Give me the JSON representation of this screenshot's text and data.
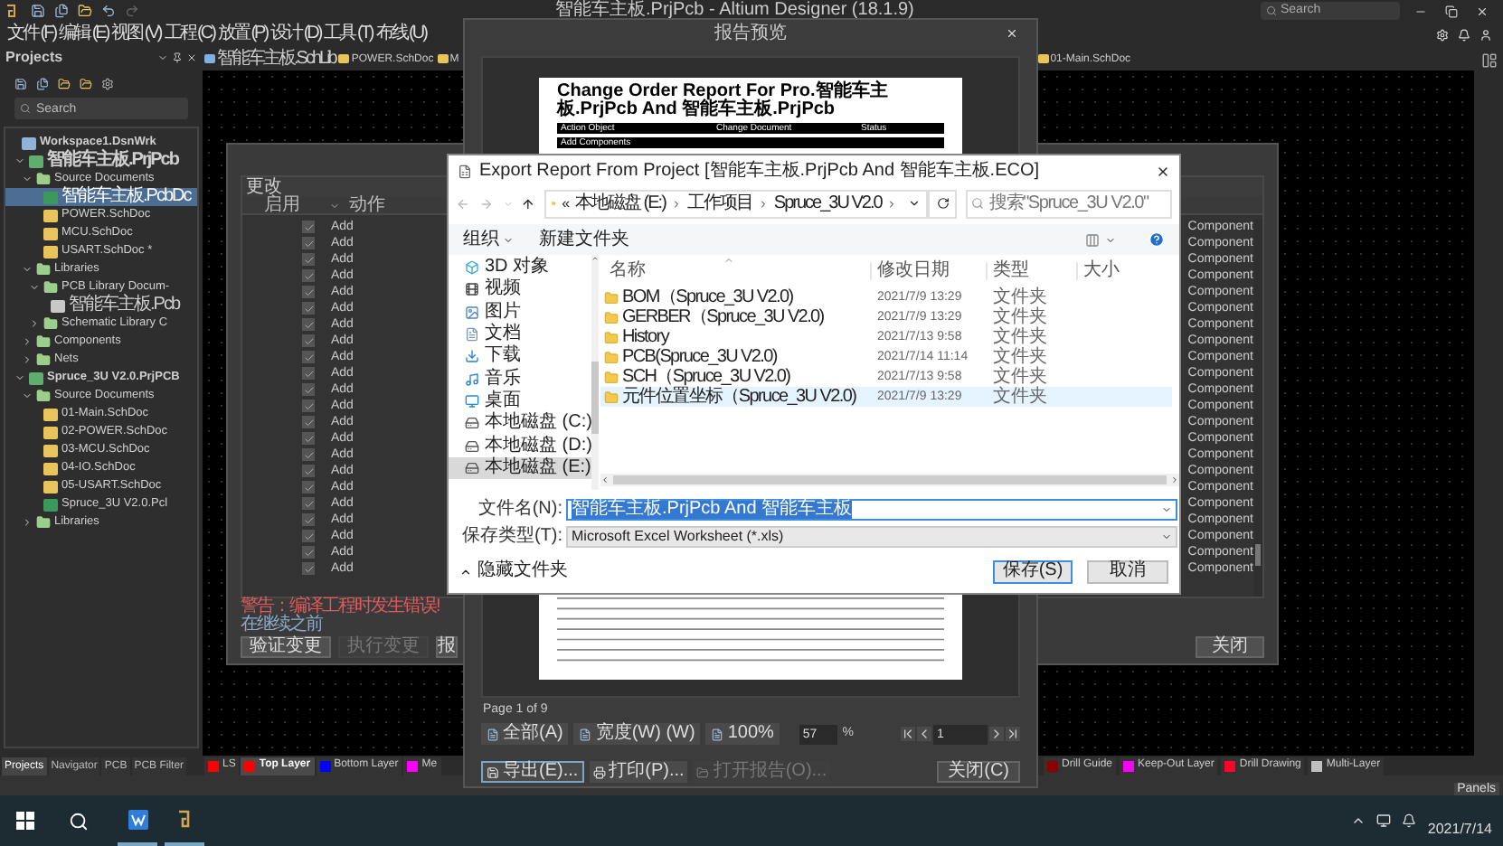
{
  "app": {
    "title": "智能车主板.PrjPcb - Altium Designer (18.1.9)",
    "search_placeholder": "Search"
  },
  "menu": [
    "文件 (F)",
    "编辑 (E)",
    "视图 (V)",
    "工程 (C)",
    "放置 (P)",
    "设计 (D)",
    "工具 (T)",
    "布线 (U)"
  ],
  "projects_panel": {
    "title": "Projects",
    "search_placeholder": "Search",
    "tree": [
      {
        "label": "Workspace1.DsnWrk",
        "kind": "workspace",
        "selected": false,
        "children": [
          {
            "label": "智能车主板.PrjPcb",
            "kind": "project",
            "selected": false,
            "expanded": true,
            "children": [
              {
                "label": "Source Documents",
                "kind": "folder",
                "selected": false,
                "expanded": true,
                "children": [
                  {
                    "label": "智能车主板.PcbDc",
                    "kind": "pcbdoc",
                    "selected": true
                  },
                  {
                    "label": "POWER.SchDoc",
                    "kind": "schdoc",
                    "selected": false
                  },
                  {
                    "label": "MCU.SchDoc",
                    "kind": "schdoc",
                    "selected": false
                  },
                  {
                    "label": "USART.SchDoc *",
                    "kind": "schdoc",
                    "selected": false
                  }
                ]
              },
              {
                "label": "Libraries",
                "kind": "folder",
                "selected": false,
                "expanded": true,
                "children": [
                  {
                    "label": "PCB Library Docum-",
                    "kind": "folder",
                    "selected": false,
                    "expanded": true,
                    "children": [
                      {
                        "label": "智能车主板.Pcb",
                        "kind": "pcblib",
                        "selected": false
                      }
                    ]
                  },
                  {
                    "label": "Schematic Library C",
                    "kind": "folder",
                    "selected": false,
                    "expanded": false
                  }
                ]
              },
              {
                "label": "Components",
                "kind": "folder",
                "selected": false,
                "expanded": false
              },
              {
                "label": "Nets",
                "kind": "folder",
                "selected": false,
                "expanded": false
              }
            ]
          },
          {
            "label": "Spruce_3U V2.0.PrjPCB",
            "kind": "project",
            "selected": false,
            "expanded": true,
            "children": [
              {
                "label": "Source Documents",
                "kind": "folder",
                "selected": false,
                "expanded": true,
                "children": [
                  {
                    "label": "01-Main.SchDoc",
                    "kind": "schdoc",
                    "selected": false
                  },
                  {
                    "label": "02-POWER.SchDoc",
                    "kind": "schdoc",
                    "selected": false
                  },
                  {
                    "label": "03-MCU.SchDoc",
                    "kind": "schdoc",
                    "selected": false
                  },
                  {
                    "label": "04-IO.SchDoc",
                    "kind": "schdoc",
                    "selected": false
                  },
                  {
                    "label": "05-USART.SchDoc",
                    "kind": "schdoc",
                    "selected": false
                  },
                  {
                    "label": "Spruce_3U V2.0.Pcl",
                    "kind": "pcbdoc",
                    "selected": false
                  }
                ]
              },
              {
                "label": "Libraries",
                "kind": "folder",
                "selected": false,
                "expanded": false
              }
            ]
          }
        ]
      }
    ]
  },
  "doc_tabs": [
    {
      "label": "智能车主板.SchLib",
      "kind": "schlib"
    },
    {
      "label": "POWER.SchDoc",
      "kind": "schdoc"
    },
    {
      "label": "M",
      "kind": "schdoc"
    },
    {
      "label": "01-Main.SchDoc",
      "kind": "schdoc"
    }
  ],
  "eco": {
    "section": "更改",
    "columns": [
      "启用",
      "动作"
    ],
    "rows": [
      {
        "enabled": true,
        "action": "Add",
        "type": "Component"
      },
      {
        "enabled": true,
        "action": "Add",
        "type": "Component"
      },
      {
        "enabled": true,
        "action": "Add",
        "type": "Component"
      },
      {
        "enabled": true,
        "action": "Add",
        "type": "Component"
      },
      {
        "enabled": true,
        "action": "Add",
        "type": "Component"
      },
      {
        "enabled": true,
        "action": "Add",
        "type": "Component"
      },
      {
        "enabled": true,
        "action": "Add",
        "type": "Component"
      },
      {
        "enabled": true,
        "action": "Add",
        "type": "Component"
      },
      {
        "enabled": true,
        "action": "Add",
        "type": "Component"
      },
      {
        "enabled": true,
        "action": "Add",
        "type": "Component"
      },
      {
        "enabled": true,
        "action": "Add",
        "type": "Component"
      },
      {
        "enabled": true,
        "action": "Add",
        "type": "Component"
      },
      {
        "enabled": true,
        "action": "Add",
        "type": "Component"
      },
      {
        "enabled": true,
        "action": "Add",
        "type": "Component"
      },
      {
        "enabled": true,
        "action": "Add",
        "type": "Component"
      },
      {
        "enabled": true,
        "action": "Add",
        "type": "Component"
      },
      {
        "enabled": true,
        "action": "Add",
        "type": "Component"
      },
      {
        "enabled": true,
        "action": "Add",
        "type": "Component"
      },
      {
        "enabled": true,
        "action": "Add",
        "type": "Component"
      },
      {
        "enabled": true,
        "action": "Add",
        "type": "Component"
      },
      {
        "enabled": true,
        "action": "Add",
        "type": "Component"
      },
      {
        "enabled": true,
        "action": "Add",
        "type": "Component"
      }
    ],
    "warning": "警告：编译工程时发生错误!",
    "warning_hint": "在继续之前",
    "buttons": [
      {
        "label": "验证变更",
        "disabled": false
      },
      {
        "label": "执行变更",
        "disabled": true
      },
      {
        "label": "报",
        "disabled": false
      }
    ],
    "close": "关闭"
  },
  "report": {
    "title": "报告预览",
    "page": {
      "heading": "Change Order Report For Pro.智能车主板.PrjPcb And 智能车主板.PrjPcb",
      "columns": [
        "Action Object",
        "Change Document",
        "Status"
      ],
      "section": "Add Components"
    },
    "page_indicator": "Page 1 of 9",
    "view_buttons": [
      "全部(A)",
      "宽度(W) (W)",
      "100%"
    ],
    "zoom": "57",
    "zoom_unit": "%",
    "page_number": "1",
    "actions": [
      {
        "label": "导出(E)...",
        "disabled": false
      },
      {
        "label": "打印(P)...",
        "disabled": false
      },
      {
        "label": "打开报告(O)...",
        "disabled": true
      }
    ],
    "close": "关闭(C)"
  },
  "export": {
    "title": "Export Report From Project [智能车主板.PrjPcb And 智能车主板.ECO]",
    "path_prefix": "«",
    "path": [
      "本地磁盘 (E:)",
      "工作项目",
      "Spruce_3U V2.0"
    ],
    "search_placeholder": "搜索\"Spruce_3U V2.0\"",
    "organize": "组织",
    "new_folder": "新建文件夹",
    "nav": [
      {
        "label": "3D 对象",
        "kind": "objects",
        "selected": false
      },
      {
        "label": "视频",
        "kind": "video",
        "selected": false
      },
      {
        "label": "图片",
        "kind": "pictures",
        "selected": false
      },
      {
        "label": "文档",
        "kind": "documents",
        "selected": false
      },
      {
        "label": "下载",
        "kind": "downloads",
        "selected": false
      },
      {
        "label": "音乐",
        "kind": "music",
        "selected": false
      },
      {
        "label": "桌面",
        "kind": "desktop",
        "selected": false
      },
      {
        "label": "本地磁盘 (C:)",
        "kind": "drive",
        "selected": false
      },
      {
        "label": "本地磁盘 (D:)",
        "kind": "drive",
        "selected": false
      },
      {
        "label": "本地磁盘 (E:)",
        "kind": "drive",
        "selected": true
      }
    ],
    "columns": [
      "名称",
      "修改日期",
      "类型",
      "大小"
    ],
    "files": [
      {
        "name": "BOM（Spruce_3U V2.0)",
        "date": "2021/7/9 13:29",
        "type": "文件夹",
        "selected": false
      },
      {
        "name": "GERBER（Spruce_3U V2.0)",
        "date": "2021/7/9 13:29",
        "type": "文件夹",
        "selected": false
      },
      {
        "name": "History",
        "date": "2021/7/13 9:58",
        "type": "文件夹",
        "selected": false
      },
      {
        "name": "PCB(Spruce_3U V2.0)",
        "date": "2021/7/14 11:14",
        "type": "文件夹",
        "selected": false
      },
      {
        "name": "SCH（Spruce_3U V2.0)",
        "date": "2021/7/13 9:58",
        "type": "文件夹",
        "selected": false
      },
      {
        "name": "元件位置坐标（Spruce_3U V2.0)",
        "date": "2021/7/9 13:29",
        "type": "文件夹",
        "selected": true
      }
    ],
    "filename_label": "文件名(N):",
    "filename": "智能车主板.PrjPcb And 智能车主板",
    "type_label": "保存类型(T):",
    "type": "Microsoft Excel Worksheet (*.xls)",
    "hide_folders": "隐藏文件夹",
    "save": "保存(S)",
    "cancel": "取消"
  },
  "panel_tabs": [
    {
      "label": "Projects",
      "selected": true
    },
    {
      "label": "Navigator",
      "selected": false
    },
    {
      "label": "PCB",
      "selected": false
    },
    {
      "label": "PCB Filter",
      "selected": false
    }
  ],
  "layers_left": [
    {
      "label": "LS",
      "color": "#ff0000",
      "selected": false
    },
    {
      "label": "Top Layer",
      "color": "#ff0000",
      "selected": true
    },
    {
      "label": "Bottom Layer",
      "color": "#0000ff",
      "selected": false
    },
    {
      "label": "Me",
      "color": "#ff00ff",
      "selected": false
    }
  ],
  "layers_right": [
    {
      "label": "Drill Guide",
      "color": "#8b0000",
      "selected": false
    },
    {
      "label": "Keep-Out Layer",
      "color": "#ff00ff",
      "selected": false
    },
    {
      "label": "Drill Drawing",
      "color": "#ff002a",
      "selected": false
    },
    {
      "label": "Multi-Layer",
      "color": "#c0c0c0",
      "selected": false
    }
  ],
  "panels_button": "Panels",
  "taskbar": {
    "date": "2021/7/14"
  }
}
